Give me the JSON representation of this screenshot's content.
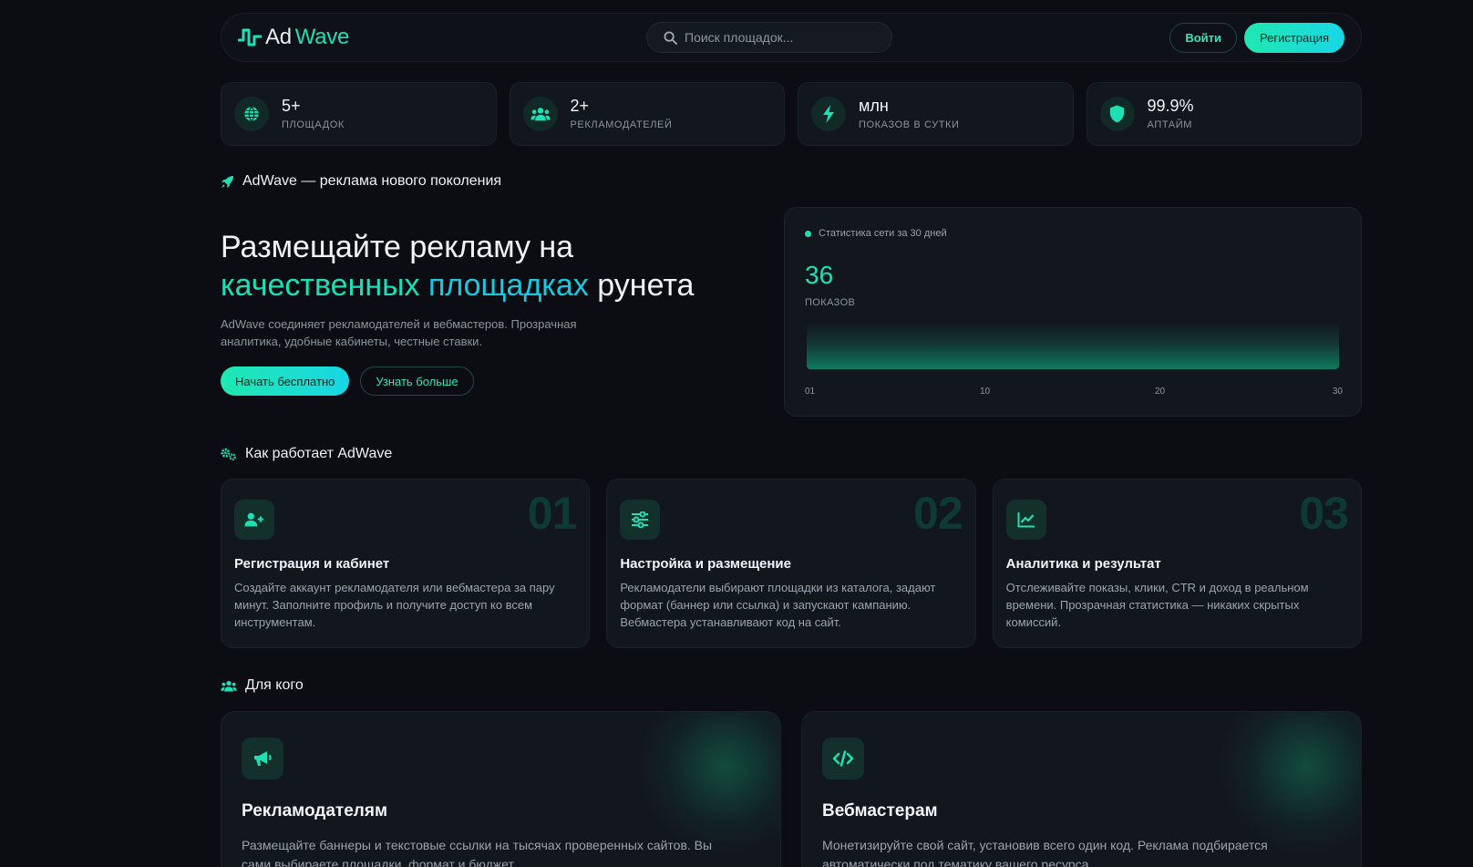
{
  "header": {
    "logo_part1": "Ad",
    "logo_part2": "Wave",
    "search_placeholder": "Поиск площадок...",
    "login_label": "Войти",
    "register_label": "Регистрация"
  },
  "stats": [
    {
      "value": "5+",
      "label": "ПЛОЩАДОК",
      "icon": "globe-icon"
    },
    {
      "value": "2+",
      "label": "РЕКЛАМОДАТЕЛЕЙ",
      "icon": "users-icon"
    },
    {
      "value": "млн",
      "label": "ПОКАЗОВ В СУТКИ",
      "icon": "bolt-icon"
    },
    {
      "value": "99.9%",
      "label": "АПТАЙМ",
      "icon": "shield-icon"
    }
  ],
  "hero": {
    "tagline": "AdWave — реклама нового поколения",
    "title_line1": "Размещайте рекламу на",
    "title_accent1": "качественных",
    "title_accent2": "площадках",
    "title_end": "рунета",
    "description": "AdWave соединяет рекламодателей и вебмастеров. Прозрачная аналитика, удобные кабинеты, честные ставки.",
    "start_label": "Начать бесплатно",
    "more_label": "Узнать больше"
  },
  "network_stats": {
    "heading": "Статистика сети за 30 дней",
    "value": "36",
    "value_label": "ПОКАЗОВ",
    "axis_ticks": [
      "01",
      "10",
      "20",
      "30"
    ]
  },
  "how": {
    "title": "Как работает AdWave",
    "steps": [
      {
        "num": "01",
        "title": "Регистрация и кабинет",
        "desc": "Создайте аккаунт рекламодателя или вебмастера за пару минут. Заполните профиль и получите доступ ко всем инструментам.",
        "icon": "user-plus-icon"
      },
      {
        "num": "02",
        "title": "Настройка и размещение",
        "desc": "Рекламодатели выбирают площадки из каталога, задают формат (баннер или ссылка) и запускают кампанию. Вебмастера устанавливают код на сайт.",
        "icon": "sliders-icon"
      },
      {
        "num": "03",
        "title": "Аналитика и результат",
        "desc": "Отслеживайте показы, клики, CTR и доход в реальном времени. Прозрачная статистика — никаких скрытых комиссий.",
        "icon": "chart-line-icon"
      }
    ]
  },
  "who": {
    "title": "Для кого",
    "cards": [
      {
        "title": "Рекламодателям",
        "desc": "Размещайте баннеры и текстовые ссылки на тысячах проверенных сайтов. Вы сами выбираете площадки, формат и бюджет.",
        "icon": "megaphone-icon"
      },
      {
        "title": "Вебмастерам",
        "desc": "Монетизируйте свой сайт, установив всего один код. Реклама подбирается автоматически под тематику вашего ресурса.",
        "icon": "code-icon"
      }
    ]
  },
  "colors": {
    "accent": "#1fe0b5",
    "accent2": "#18c9e0",
    "background": "#0b0d12",
    "card": "#12161d"
  }
}
